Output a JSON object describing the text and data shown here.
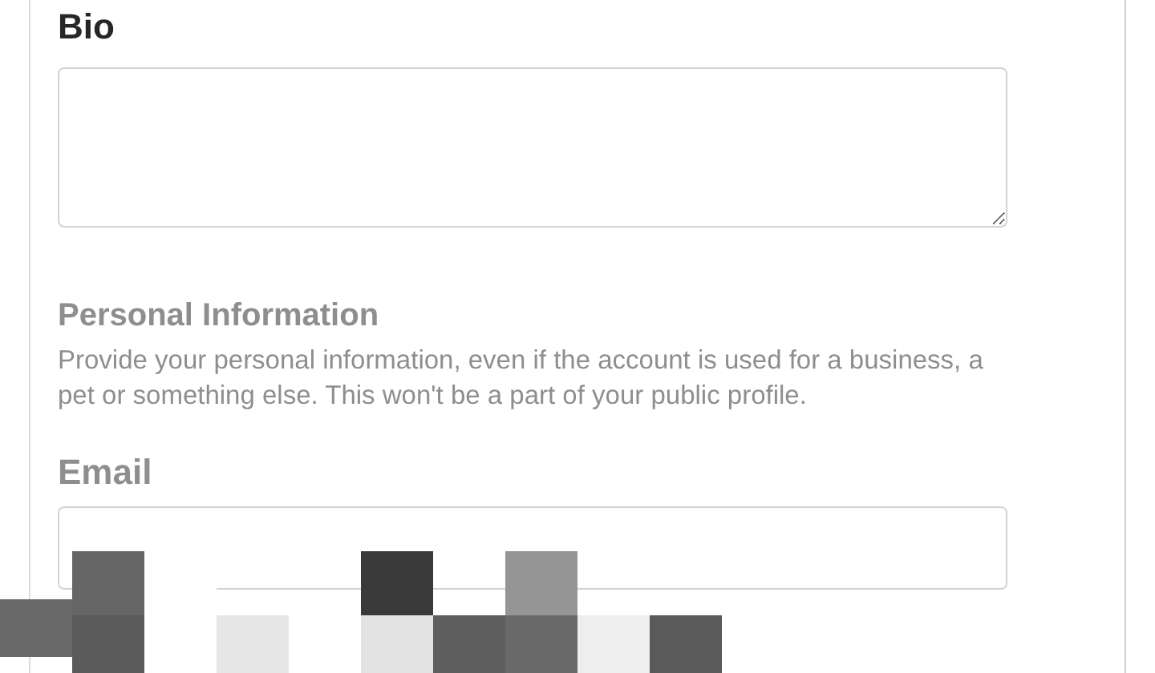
{
  "bio": {
    "label": "Bio"
  },
  "personal_information": {
    "heading": "Personal Information",
    "description": "Provide your personal information, even if the account is used for a business, a pet or something else. This won't be a part of your public profile."
  },
  "email": {
    "label": "Email"
  }
}
